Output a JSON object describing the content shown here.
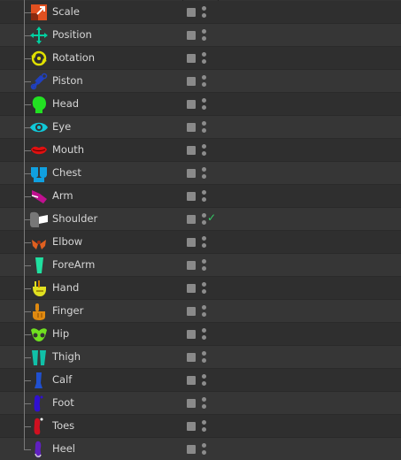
{
  "rows": [
    {
      "label": "Scale",
      "icon": "scale-icon",
      "color": "#e05020",
      "checked": false
    },
    {
      "label": "Position",
      "icon": "position-icon",
      "color": "#00d0a0",
      "checked": false
    },
    {
      "label": "Rotation",
      "icon": "rotation-icon",
      "color": "#e0e000",
      "checked": false
    },
    {
      "label": "Piston",
      "icon": "piston-icon",
      "color": "#2040c0",
      "checked": false
    },
    {
      "label": "Head",
      "icon": "head-icon",
      "color": "#22e022",
      "checked": false
    },
    {
      "label": "Eye",
      "icon": "eye-icon",
      "color": "#10c8d8",
      "checked": false
    },
    {
      "label": "Mouth",
      "icon": "mouth-icon",
      "color": "#e01010",
      "checked": false
    },
    {
      "label": "Chest",
      "icon": "chest-icon",
      "color": "#10a0e0",
      "checked": false
    },
    {
      "label": "Arm",
      "icon": "arm-icon",
      "color": "#c01090",
      "checked": false
    },
    {
      "label": "Shoulder",
      "icon": "shoulder-icon",
      "color": "#d0d0d0",
      "checked": true
    },
    {
      "label": "Elbow",
      "icon": "elbow-icon",
      "color": "#e06020",
      "checked": false
    },
    {
      "label": "ForeArm",
      "icon": "forearm-icon",
      "color": "#20e0a0",
      "checked": false
    },
    {
      "label": "Hand",
      "icon": "hand-icon",
      "color": "#e0e020",
      "checked": false
    },
    {
      "label": "Finger",
      "icon": "finger-icon",
      "color": "#e08a10",
      "checked": false
    },
    {
      "label": "Hip",
      "icon": "hip-icon",
      "color": "#70e020",
      "checked": false
    },
    {
      "label": "Thigh",
      "icon": "thigh-icon",
      "color": "#10c0a8",
      "checked": false
    },
    {
      "label": "Calf",
      "icon": "calf-icon",
      "color": "#2050d0",
      "checked": false
    },
    {
      "label": "Foot",
      "icon": "foot-icon",
      "color": "#3010d0",
      "checked": false
    },
    {
      "label": "Toes",
      "icon": "toes-icon",
      "color": "#d01020",
      "checked": false
    },
    {
      "label": "Heel",
      "icon": "heel-icon",
      "color": "#6020c0",
      "checked": false
    }
  ],
  "colors": {
    "check_mark": "#33cc66",
    "checkbox": "#8a8a8a",
    "text": "#d6d6d6",
    "row_odd": "#2f2f2f",
    "row_even": "#363636"
  },
  "check_glyph": "✓"
}
